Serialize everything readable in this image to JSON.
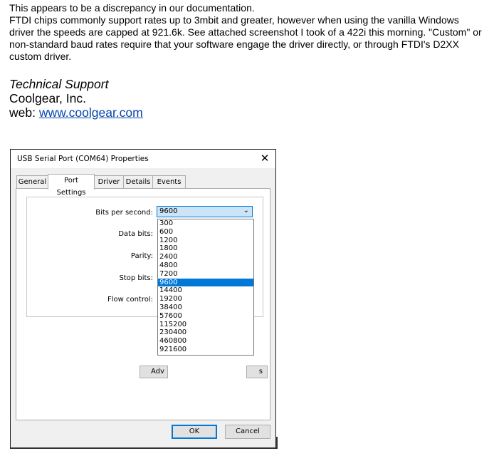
{
  "email": {
    "line1": "This appears to be a discrepancy in our documentation.",
    "line2": "FTDI chips commonly support rates up to 3mbit and greater, however when using the vanilla Windows driver the speeds are capped at 921.6k. See attached screenshot I took of a 422i this morning. \"Custom\" or non-standard baud rates require that your software engage the driver directly, or through FTDI's D2XX custom driver."
  },
  "signature": {
    "title": "Technical Support",
    "company": "Coolgear, Inc.",
    "web_prefix": "web: ",
    "web_link": "www.coolgear.com"
  },
  "dialog": {
    "title": "USB Serial Port (COM64) Properties",
    "close_glyph": "✕",
    "tabs": [
      "General",
      "Port Settings",
      "Driver",
      "Details",
      "Events"
    ],
    "labels": {
      "bits_per_second": "Bits per second:",
      "data_bits": "Data bits:",
      "parity": "Parity:",
      "stop_bits": "Stop bits:",
      "flow_control": "Flow control:"
    },
    "selected_value": "9600",
    "chevron": "⌄",
    "options": [
      "300",
      "600",
      "1200",
      "1800",
      "2400",
      "4800",
      "7200",
      "9600",
      "14400",
      "19200",
      "38400",
      "57600",
      "115200",
      "230400",
      "460800",
      "921600"
    ],
    "advanced_partial": "Adv",
    "restore_partial": "s",
    "ok_label": "OK",
    "cancel_label": "Cancel"
  }
}
